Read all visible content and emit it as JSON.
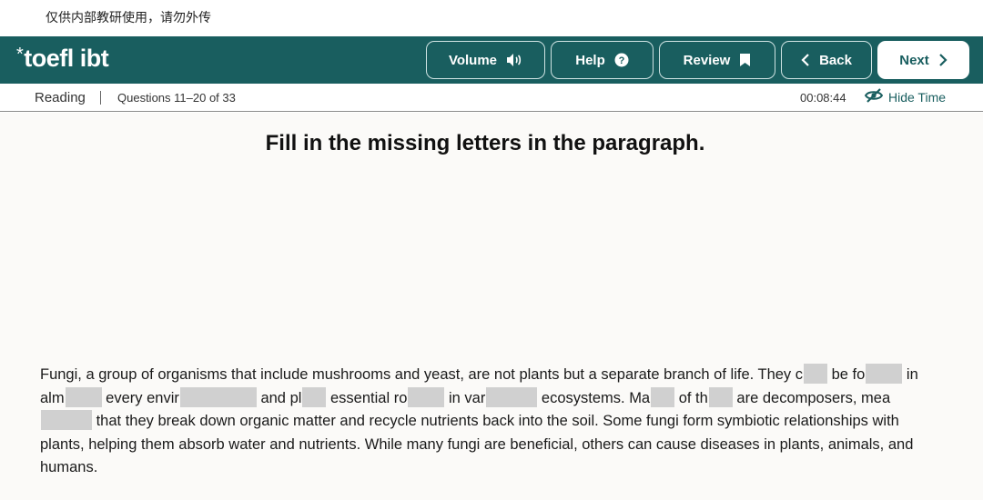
{
  "watermark": "仅供内部教研使用，请勿外传",
  "header": {
    "logo_text": "toefl ibt",
    "buttons": {
      "volume": "Volume",
      "help": "Help",
      "review": "Review",
      "back": "Back",
      "next": "Next"
    }
  },
  "subheader": {
    "section": "Reading",
    "questions": "Questions 11–20 of 33",
    "timer": "00:08:44",
    "hide_time": "Hide Time"
  },
  "main": {
    "instruction": "Fill in the missing letters in the paragraph.",
    "paragraph": {
      "s1": "Fungi, a group of organisms that include mushrooms and yeast, are not plants but a separate branch of life. They c",
      "s2": " be fo",
      "s3": " in alm",
      "s4": " every envir",
      "s5": " and pl",
      "s6": " essential ro",
      "s7": " in var",
      "s8": " ecosystems. Ma",
      "s9": " of th",
      "s10": " are decomposers, mea",
      "s11": " that they break down organic matter and recycle nutrients back into the soil. Some fungi form symbiotic relationships with plants, helping them absorb water and nutrients. While many fungi are beneficial, others can cause diseases in plants, animals, and humans."
    }
  },
  "colors": {
    "header_bg": "#195e5f",
    "blank_fill": "#d0d0d0",
    "content_bg": "#fbfaf8"
  }
}
